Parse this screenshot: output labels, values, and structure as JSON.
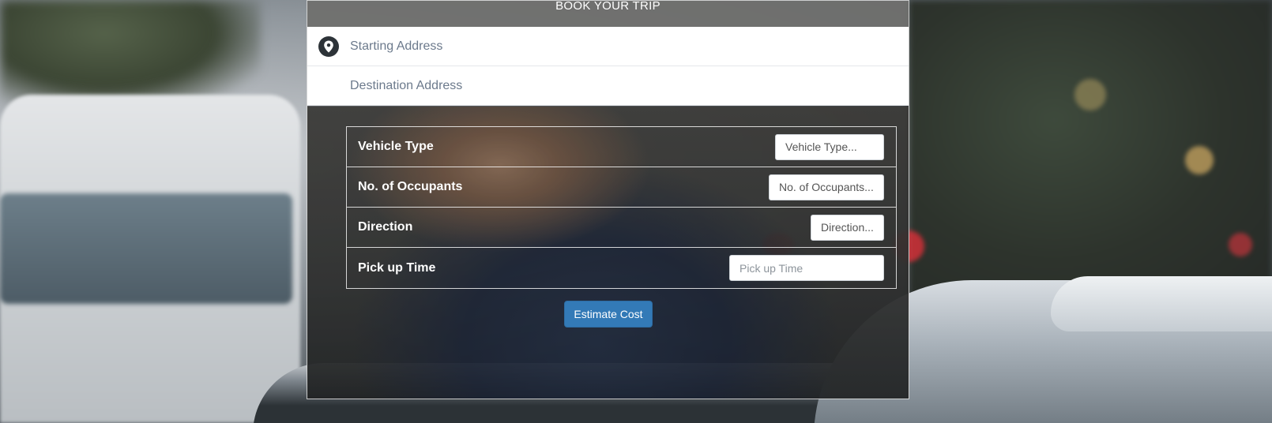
{
  "form": {
    "title": "BOOK YOUR TRIP",
    "starting_address": "Starting Address",
    "destination_address": "Destination Address",
    "location_icon": "map-pin-icon"
  },
  "fields": [
    {
      "label": "Vehicle Type",
      "value": "Vehicle Type..."
    },
    {
      "label": "No. of Occupants",
      "value": "No. of Occupants..."
    },
    {
      "label": "Direction",
      "value": "Direction..."
    },
    {
      "label": "Pick up Time",
      "placeholder": "Pick up Time"
    }
  ],
  "actions": {
    "estimate_label": "Estimate Cost"
  },
  "colors": {
    "button": "#337ab7",
    "header": "#787876",
    "address_text": "#6c7a8c"
  }
}
